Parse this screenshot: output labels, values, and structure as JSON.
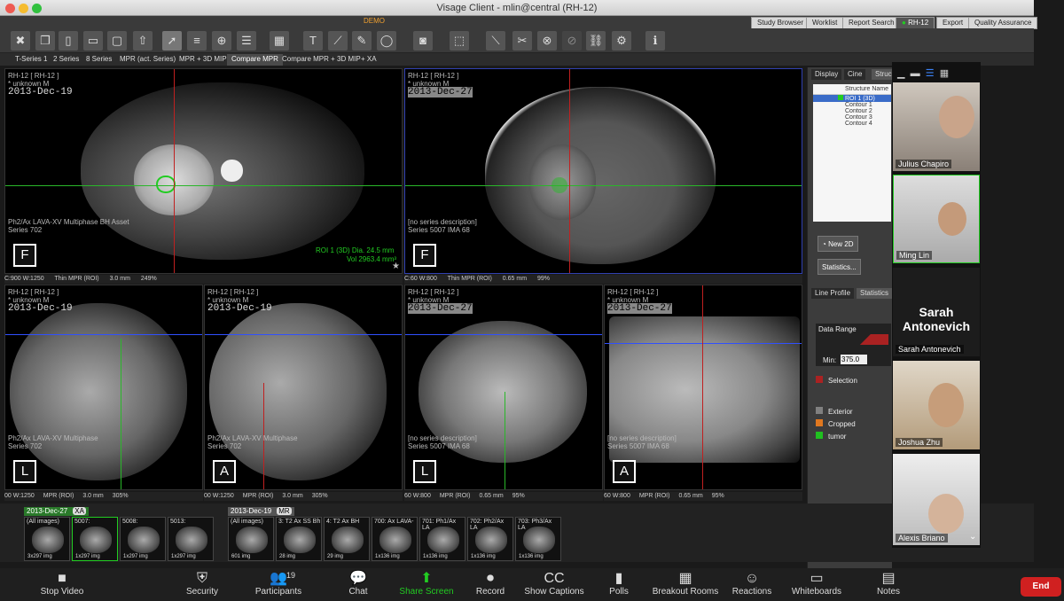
{
  "window": {
    "title": "Visage Client - mlin@central (RH-12)",
    "mode": "DEMO"
  },
  "nav_tabs": [
    "Study Browser",
    "Worklist",
    "Report Search",
    "RH-12",
    "Export",
    "Quality Assurance"
  ],
  "layout_tabs": [
    "T-Series 1",
    "2 Series",
    "8 Series",
    "MPR (act. Series)",
    "MPR + 3D MIP",
    "Compare MPR",
    "Compare MPR + 3D MIP",
    "+ XA"
  ],
  "layout_active": 5,
  "right_tabs": [
    "Display",
    "Cine",
    "Struc"
  ],
  "structures": {
    "header": "Structure Name",
    "items": [
      "ROI 1 (3D)",
      "Contour 1",
      "Contour 2",
      "Contour 3",
      "Contour 4"
    ]
  },
  "buttons": {
    "new2d": "New 2D",
    "statistics": "Statistics...",
    "line_profile": "Line Profile",
    "stats_tab": "Statistics",
    "data_range": "Data Range",
    "min_label": "Min:",
    "min_value": "375.0",
    "selection": "Selection"
  },
  "legend": [
    {
      "label": "Exterior",
      "color": "#808080"
    },
    {
      "label": "Cropped",
      "color": "#e07820"
    },
    {
      "label": "tumor",
      "color": "#20c020"
    }
  ],
  "viewports": [
    {
      "hdr": "RH-12 [ RH-12 ]",
      "sub": "* unknown M",
      "date": "2013-Dec-19",
      "desc": "Ph2/Ax LAVA-XV Multiphase BH Asset",
      "series": "Series 702",
      "orient": "F",
      "roi": "ROI 1 (3D) Dia. 24.5 mm",
      "vol": "Vol 2963.4 mm³",
      "status": [
        "C:900 W:1250",
        "Thin MPR (ROI)",
        "3.0 mm",
        "249%"
      ]
    },
    {
      "hdr": "RH-12 [ RH-12 ]",
      "sub": "* unknown M",
      "date": "2013-Dec-27",
      "desc": "[no series description]",
      "series": "Series 5007 IMA 68",
      "orient": "F",
      "status": [
        "C:60 W:800",
        "Thin MPR (ROI)",
        "0.65 mm",
        "99%"
      ]
    },
    {
      "hdr": "RH-12 [ RH-12 ]",
      "sub": "* unknown M",
      "date": "2013-Dec-19",
      "desc": "Ph2/Ax LAVA-XV Multiphase",
      "series": "Series 702",
      "orient": "L",
      "status": [
        "00 W:1250",
        "MPR (ROI)",
        "3.0 mm",
        "305%"
      ]
    },
    {
      "hdr": "RH-12 [ RH-12 ]",
      "sub": "* unknown M",
      "date": "2013-Dec-19",
      "desc": "Ph2/Ax LAVA-XV Multiphase",
      "series": "Series 702",
      "orient": "A",
      "status": [
        "00 W:1250",
        "MPR (ROI)",
        "3.0 mm",
        "305%"
      ]
    },
    {
      "hdr": "RH-12 [ RH-12 ]",
      "sub": "* unknown M",
      "date": "2013-Dec-27",
      "desc": "[no series description]",
      "series": "Series 5007 IMA 68",
      "orient": "L",
      "status": [
        "60 W:800",
        "MPR (ROI)",
        "0.65 mm",
        "95%"
      ]
    },
    {
      "hdr": "RH-12 [ RH-12 ]",
      "sub": "* unknown M",
      "date": "2013-Dec-27",
      "desc": "[no series description]",
      "series": "Series 5007 IMA 68",
      "orient": "A",
      "status": [
        "60 W:800",
        "MPR (ROI)",
        "0.65 mm",
        "95%"
      ]
    }
  ],
  "thumb_groups": [
    {
      "date": "2013-Dec-27",
      "tag": "XA",
      "items": [
        {
          "t": "(All images)",
          "b": "3x297 img"
        },
        {
          "t": "5007:",
          "b": "1x297 img"
        },
        {
          "t": "5008:",
          "b": "1x297 img"
        },
        {
          "t": "5013:",
          "b": "1x297 img"
        }
      ]
    },
    {
      "date": "2013-Dec-19",
      "tag": "MR",
      "items": [
        {
          "t": "(All images)",
          "b": "601 img"
        },
        {
          "t": "3: T2 Ax SS Bh",
          "b": "28 img"
        },
        {
          "t": "4: T2 Ax BH",
          "b": "29 img"
        },
        {
          "t": "700: Ax LAVA-",
          "b": "1x136 img"
        },
        {
          "t": "701: Ph1/Ax LA",
          "b": "1x136 img"
        },
        {
          "t": "702: Ph2/Ax LA",
          "b": "1x136 img"
        },
        {
          "t": "703: Ph3/Ax LA",
          "b": "1x136 img"
        }
      ]
    }
  ],
  "participants": [
    {
      "name": "Julius Chapiro"
    },
    {
      "name": "Ming Lin"
    },
    {
      "name": "Sarah Antonevich",
      "big": "Sarah Antonevich"
    },
    {
      "name": "Joshua Zhu"
    },
    {
      "name": "Alexis Briano"
    }
  ],
  "taskbar": [
    {
      "label": "Stop Video",
      "icon": "■"
    },
    {
      "label": "Security",
      "icon": "⛨"
    },
    {
      "label": "Participants",
      "icon": "👥",
      "badge": "19"
    },
    {
      "label": "Chat",
      "icon": "💬"
    },
    {
      "label": "Share Screen",
      "icon": "⬆"
    },
    {
      "label": "Record",
      "icon": "⏺"
    },
    {
      "label": "Show Captions",
      "icon": "CC"
    },
    {
      "label": "Polls",
      "icon": "▮"
    },
    {
      "label": "Breakout Rooms",
      "icon": "▦"
    },
    {
      "label": "Reactions",
      "icon": "☺"
    },
    {
      "label": "Whiteboards",
      "icon": "▭"
    },
    {
      "label": "Notes",
      "icon": "▤"
    }
  ],
  "end_label": "End"
}
